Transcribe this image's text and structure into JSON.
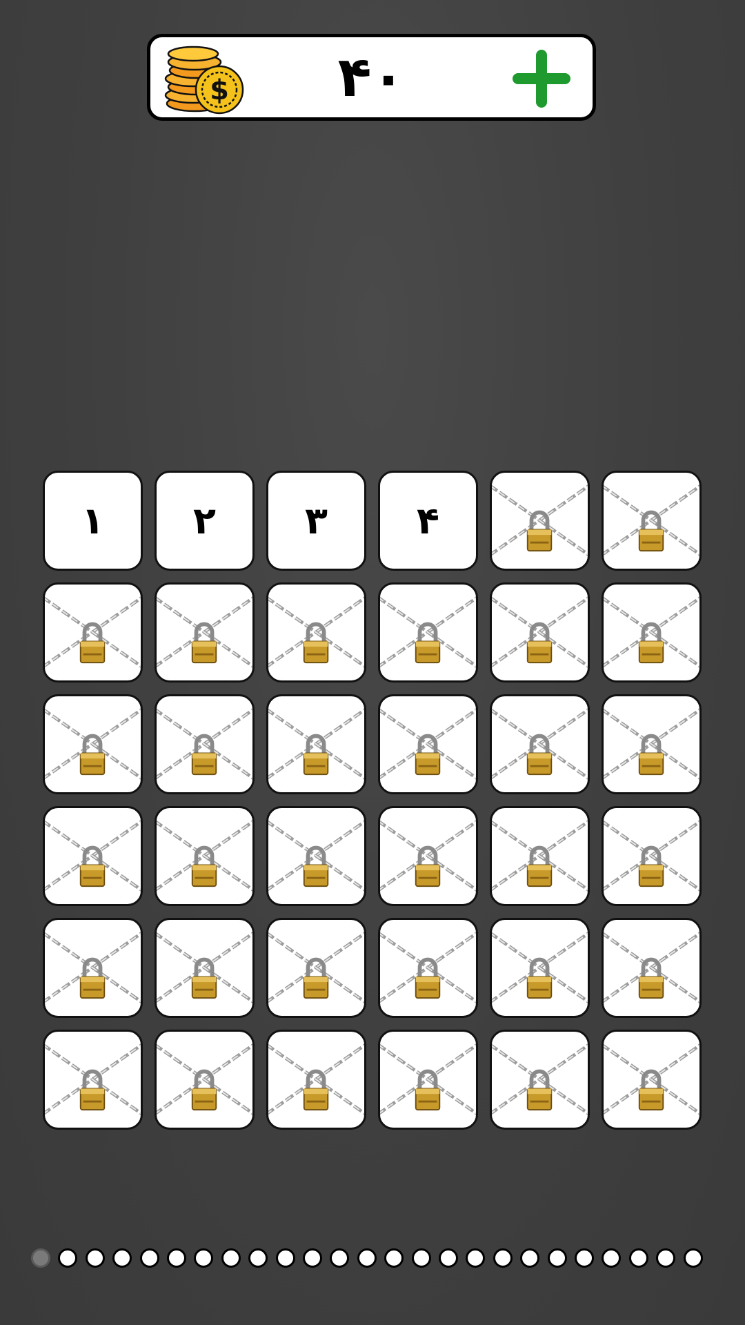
{
  "coins": {
    "count": "۴۰",
    "icon": "coin-stack-icon",
    "add_icon": "plus-icon",
    "add_color": "#1e9a2e"
  },
  "levels": [
    {
      "label": "۱",
      "locked": false
    },
    {
      "label": "۲",
      "locked": false
    },
    {
      "label": "۳",
      "locked": false
    },
    {
      "label": "۴",
      "locked": false
    },
    {
      "label": "",
      "locked": true
    },
    {
      "label": "",
      "locked": true
    },
    {
      "label": "",
      "locked": true
    },
    {
      "label": "",
      "locked": true
    },
    {
      "label": "",
      "locked": true
    },
    {
      "label": "",
      "locked": true
    },
    {
      "label": "",
      "locked": true
    },
    {
      "label": "",
      "locked": true
    },
    {
      "label": "",
      "locked": true
    },
    {
      "label": "",
      "locked": true
    },
    {
      "label": "",
      "locked": true
    },
    {
      "label": "",
      "locked": true
    },
    {
      "label": "",
      "locked": true
    },
    {
      "label": "",
      "locked": true
    },
    {
      "label": "",
      "locked": true
    },
    {
      "label": "",
      "locked": true
    },
    {
      "label": "",
      "locked": true
    },
    {
      "label": "",
      "locked": true
    },
    {
      "label": "",
      "locked": true
    },
    {
      "label": "",
      "locked": true
    },
    {
      "label": "",
      "locked": true
    },
    {
      "label": "",
      "locked": true
    },
    {
      "label": "",
      "locked": true
    },
    {
      "label": "",
      "locked": true
    },
    {
      "label": "",
      "locked": true
    },
    {
      "label": "",
      "locked": true
    },
    {
      "label": "",
      "locked": true
    },
    {
      "label": "",
      "locked": true
    },
    {
      "label": "",
      "locked": true
    },
    {
      "label": "",
      "locked": true
    },
    {
      "label": "",
      "locked": true
    },
    {
      "label": "",
      "locked": true
    }
  ],
  "lock_icon": "chained-padlock-icon",
  "pager": {
    "pages": 25,
    "current": 1
  }
}
